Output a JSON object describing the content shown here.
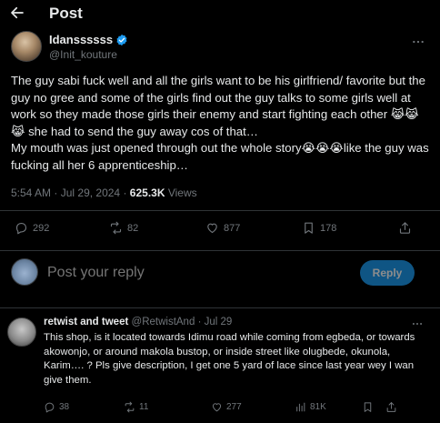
{
  "header": {
    "title": "Post"
  },
  "author": {
    "display_name": "Idanssssss",
    "handle": "@Init_kouture"
  },
  "tweet": {
    "text": "The guy sabi fuck well and all the girls want to be his girlfriend/ favorite but the guy no gree and some of the girls find out the guy talks to some girls well at work so they made those girls their enemy and start fighting each other 😹😹😹 she had to send the guy away cos of that…\nMy mouth was just opened through out the whole story😭😭😭like the guy was fucking all her 6 apprenticeship…",
    "time": "5:54 AM",
    "date": "Jul 29, 2024",
    "views_count": "625.3K",
    "views_label": "Views",
    "replies": "292",
    "reposts": "82",
    "likes": "877",
    "bookmarks": "178"
  },
  "reply_composer": {
    "placeholder": "Post your reply",
    "button_label": "Reply"
  },
  "reply": {
    "display_name": "retwist and tweet",
    "handle": "@RetwistAnd",
    "dot": "·",
    "time": "Jul 29",
    "text": "This shop, is it located towards Idimu road while coming from egbeda, or towards akowonjo, or around makola bustop, or inside street like olugbede, okunola, Karim…. ?  Pls give description, I get one 5 yard of lace since last year wey I wan give them.",
    "replies": "38",
    "reposts": "11",
    "likes": "277",
    "views": "81K"
  },
  "colors": {
    "accent": "#1d9bf0",
    "muted": "#71767b",
    "text": "#e7e9ea",
    "border": "#2f3336",
    "background": "#000000"
  }
}
